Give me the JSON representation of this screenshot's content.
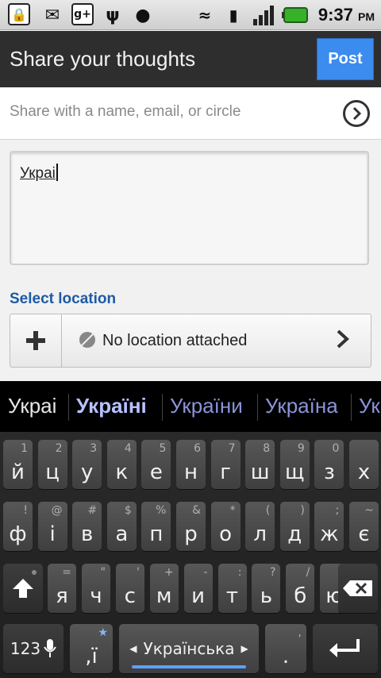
{
  "status_bar": {
    "time": "9:37",
    "ampm": "PM",
    "icons": [
      "lock-icon",
      "messages-icon",
      "google-plus-icon",
      "usb-icon",
      "android-debug-icon",
      "wifi-icon",
      "vibrate-icon",
      "signal-icon",
      "battery-icon"
    ]
  },
  "header": {
    "title": "Share your thoughts",
    "post_label": "Post"
  },
  "share": {
    "placeholder": "Share with a name, email, or circle"
  },
  "compose": {
    "text": "Украі"
  },
  "location": {
    "section_label": "Select location",
    "status": "No location attached"
  },
  "suggestions": [
    "Украі",
    "Україні",
    "України",
    "Україна",
    "Ук"
  ],
  "keyboard": {
    "row1": [
      {
        "main": "й",
        "hint": "1"
      },
      {
        "main": "ц",
        "hint": "2"
      },
      {
        "main": "у",
        "hint": "3"
      },
      {
        "main": "к",
        "hint": "4"
      },
      {
        "main": "е",
        "hint": "5"
      },
      {
        "main": "н",
        "hint": "6"
      },
      {
        "main": "г",
        "hint": "7"
      },
      {
        "main": "ш",
        "hint": "8"
      },
      {
        "main": "щ",
        "hint": "9"
      },
      {
        "main": "з",
        "hint": "0"
      },
      {
        "main": "х",
        "hint": ""
      }
    ],
    "row2": [
      {
        "main": "ф",
        "hint": "!"
      },
      {
        "main": "і",
        "hint": "@"
      },
      {
        "main": "в",
        "hint": "#"
      },
      {
        "main": "а",
        "hint": "$"
      },
      {
        "main": "п",
        "hint": "%"
      },
      {
        "main": "р",
        "hint": "&"
      },
      {
        "main": "о",
        "hint": "*"
      },
      {
        "main": "л",
        "hint": "("
      },
      {
        "main": "д",
        "hint": ")"
      },
      {
        "main": "ж",
        "hint": ";"
      },
      {
        "main": "є",
        "hint": "~"
      }
    ],
    "row3": [
      {
        "main": "я",
        "hint": "="
      },
      {
        "main": "ч",
        "hint": "\""
      },
      {
        "main": "с",
        "hint": "'"
      },
      {
        "main": "м",
        "hint": "+"
      },
      {
        "main": "и",
        "hint": "-"
      },
      {
        "main": "т",
        "hint": ":"
      },
      {
        "main": "ь",
        "hint": "?"
      },
      {
        "main": "б",
        "hint": "/"
      },
      {
        "main": "ю",
        "hint": "["
      }
    ],
    "symbols_label": "123",
    "yi_label": ",ї",
    "yi_hint": "★",
    "language_label": "Українська",
    "period_label": ".",
    "period_hint": ","
  }
}
